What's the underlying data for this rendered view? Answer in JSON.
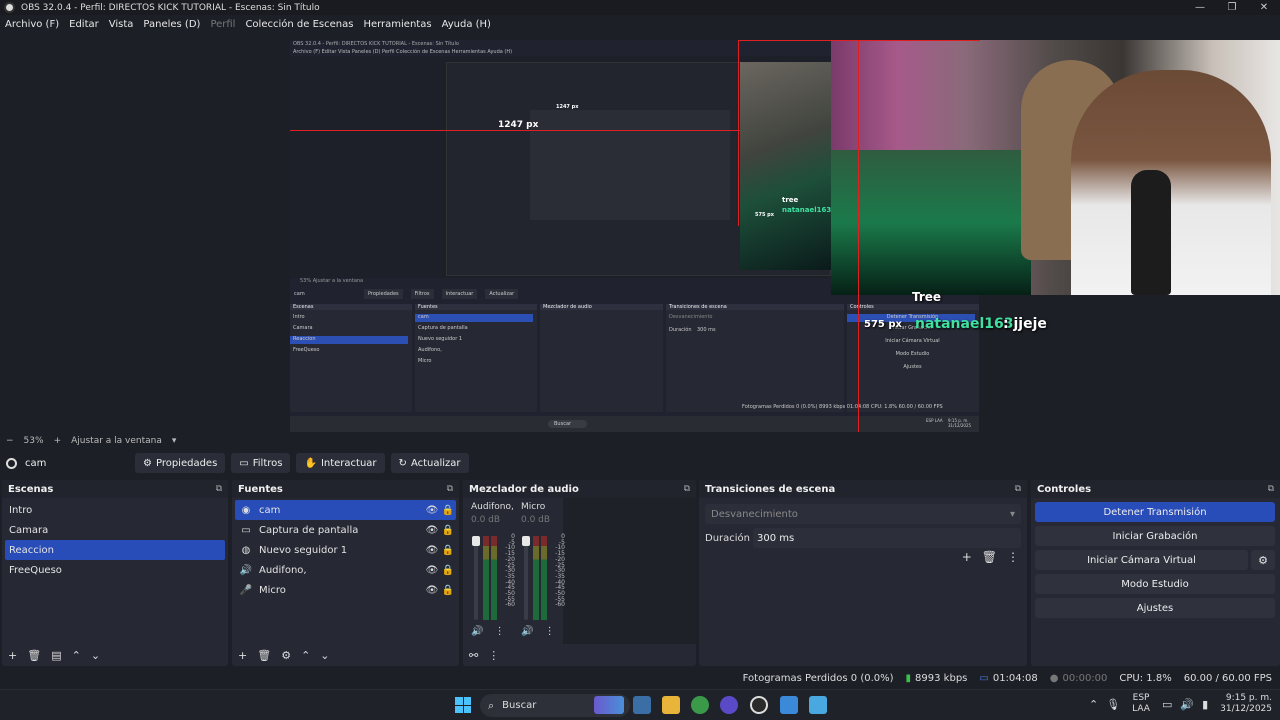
{
  "window": {
    "title": "OBS 32.0.4 - Perfil: DIRECTOS KICK TUTORIAL - Escenas: Sin Título",
    "controls": [
      "minimize",
      "restore",
      "close"
    ]
  },
  "menu": {
    "items": [
      "Archivo (F)",
      "Editar",
      "Vista",
      "Paneles (D)",
      "Perfil",
      "Colección de Escenas",
      "Herramientas",
      "Ayuda (H)"
    ]
  },
  "preview": {
    "overlay_labels": {
      "width_big": "1247 px",
      "height_label": "575 px",
      "inner_width": "1247 px",
      "inner_height": "575 px",
      "tree_label": "tree",
      "tree_label_big": "Tree",
      "inner_chat_name": "natanael163"
    },
    "chat": {
      "name": "natanael163",
      "message": ": jjeje"
    },
    "inner_title": "OBS 32.0.4 - Perfil: DIRECTOS KICK TUTORIAL - Escenas: Sin Título",
    "inner_menu": "Archivo (F)   Editar   Vista   Paneles (D)   Perfil   Colección de Escenas   Herramientas   Ayuda (H)",
    "inner_scenes": [
      "Intro",
      "Camara",
      "Reaccion",
      "FreeQueso"
    ],
    "inner_sources": [
      "cam",
      "Captura de pantalla",
      "Nuevo seguidor 1",
      "Audifono,",
      "Micro"
    ],
    "inner_controls": [
      "Detener Transmisión",
      "Iniciar Grabación",
      "Iniciar Cámara Virtual",
      "Modo Estudio",
      "Ajustes"
    ],
    "inner_toolbar": [
      "cam",
      "Propiedades",
      "Filtros",
      "Interactuar",
      "Actualizar"
    ],
    "inner_docks": [
      "Escenas",
      "Fuentes",
      "Mezclador de audio",
      "Transiciones de escena",
      "Controles"
    ],
    "inner_transition": "Desvanecimiento",
    "inner_duration_label": "Duración",
    "inner_duration": "300 ms",
    "inner_status": "Fotogramas Perdidos 0 (0.0%)   8993 kbps   01:04:08   CPU: 1.8%   60.00 / 60.00 FPS",
    "inner_zoom": "53%   Ajustar a la ventana",
    "inner_search": "Buscar",
    "inner_lang": "ESP LAA",
    "inner_clock": "9:15 p. m. 31/12/2025"
  },
  "zoom": {
    "minus": "−",
    "level": "53%",
    "plus": "+",
    "fit_label": "Ajustar a la ventana"
  },
  "source_toolbar": {
    "source_name": "cam",
    "buttons": [
      {
        "label": "Propiedades",
        "icon": "gear-icon"
      },
      {
        "label": "Filtros",
        "icon": "filter-icon"
      },
      {
        "label": "Interactuar",
        "icon": "hand-icon"
      },
      {
        "label": "Actualizar",
        "icon": "refresh-icon"
      }
    ]
  },
  "scenes": {
    "title": "Escenas",
    "items": [
      "Intro",
      "Camara",
      "Reaccion",
      "FreeQueso"
    ],
    "selected": "Reaccion"
  },
  "sources": {
    "title": "Fuentes",
    "items": [
      {
        "label": "cam",
        "icon": "camera-icon"
      },
      {
        "label": "Captura de pantalla",
        "icon": "monitor-icon"
      },
      {
        "label": "Nuevo seguidor 1",
        "icon": "browser-icon"
      },
      {
        "label": "Audifono,",
        "icon": "speaker-icon"
      },
      {
        "label": "Micro",
        "icon": "microphone-icon"
      }
    ],
    "selected": "cam"
  },
  "mixer": {
    "title": "Mezclador de audio",
    "channels": [
      {
        "name": "Audifono,",
        "db": "0.0 dB"
      },
      {
        "name": "Micro",
        "db": "0.0 dB"
      }
    ],
    "scale": [
      "0",
      "-5",
      "-10",
      "-15",
      "-20",
      "-25",
      "-30",
      "-35",
      "-40",
      "-45",
      "-50",
      "-55",
      "-60"
    ]
  },
  "transitions": {
    "title": "Transiciones de escena",
    "selected": "Desvanecimiento",
    "duration_label": "Duración",
    "duration_value": "300 ms"
  },
  "controls": {
    "title": "Controles",
    "buttons": [
      "Detener Transmisión",
      "Iniciar Grabación",
      "Iniciar Cámara Virtual",
      "Modo Estudio",
      "Ajustes"
    ]
  },
  "status": {
    "dropped_frames": "Fotogramas Perdidos 0 (0.0%)",
    "bitrate": "8993 kbps",
    "stream_time": "01:04:08",
    "record_time": "00:00:00",
    "cpu": "CPU: 1.8%",
    "fps": "60.00 / 60.00 FPS"
  },
  "taskbar": {
    "search_placeholder": "Buscar",
    "lang_line1": "ESP",
    "lang_line2": "LAA",
    "time": "9:15 p. m.",
    "date": "31/12/2025"
  },
  "colors": {
    "accent": "#284cb8",
    "panel": "#262833",
    "background": "#1d1f26",
    "overlay_red": "#e02020",
    "chat_name": "#3fe0a0"
  }
}
